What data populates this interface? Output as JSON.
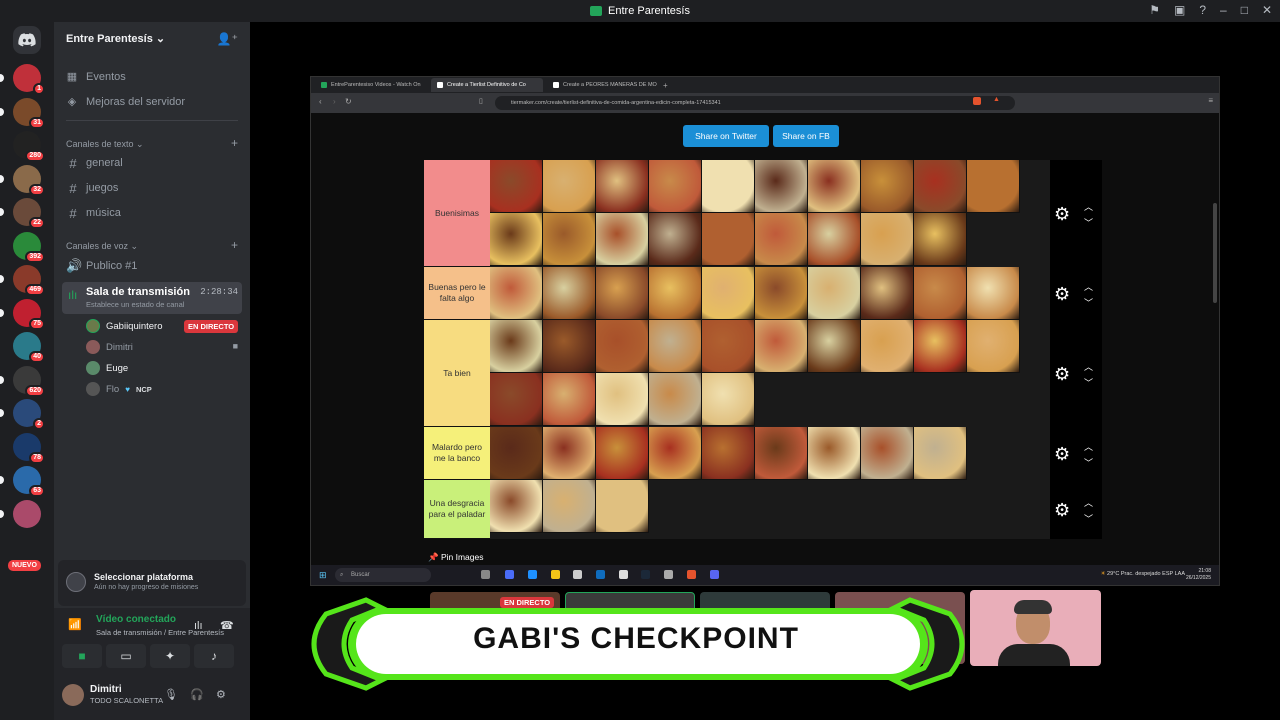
{
  "window": {
    "title": "Entre Parentesís"
  },
  "servers": {
    "badges": [
      "1",
      "31",
      "280",
      "32",
      "22",
      "392",
      "469",
      "75",
      "40",
      "620",
      "2",
      "78",
      "63"
    ],
    "nuevo": "NUEVO"
  },
  "channels": {
    "guild_name": "Entre Parentesís",
    "top_items": [
      "Eventos",
      "Mejoras del servidor"
    ],
    "text_category": "Canales de texto",
    "text_channels": [
      "general",
      "juegos",
      "música"
    ],
    "voice_category": "Canales de voz",
    "voice_channels": [
      "Publico #1"
    ],
    "stage": {
      "name": "Sala de transmisión",
      "status": "Establece un estado de canal",
      "timer": "2:28:34"
    },
    "members": [
      {
        "name": "Gabiiquintero",
        "color": "#f2f3f5",
        "badge": "EN DIRECTO"
      },
      {
        "name": "Dimitri",
        "color": "#949ba4"
      },
      {
        "name": "Euge",
        "color": "#f2f3f5"
      },
      {
        "name": "Flo",
        "color": "#949ba4",
        "tag": "NCP"
      }
    ]
  },
  "platform_panel": {
    "title": "Seleccionar plataforma",
    "subtitle": "Aún no hay progreso de misiones"
  },
  "voice_panel": {
    "title": "Vídeo conectado",
    "subtitle": "Sala de transmisión / Entre Parentesís"
  },
  "user_panel": {
    "name": "Dimitri",
    "status": "TODO SCALONETTA"
  },
  "browser": {
    "tabs": [
      "EntreParentesiso Videos - Watch On",
      "Create a Tierlist Definitivo de Co",
      "Create a PEORES MANERAS DE MO"
    ],
    "url": "tiermaker.com/create/tierlist-definitiva-de-comida-argentina-edicin-completa-17415341",
    "share_twitter": "Share on Twitter",
    "share_fb": "Share on FB",
    "pin_images": "Pin Images",
    "taskbar_search": "Buscar",
    "weather": "29°C  Prac. despejado",
    "time": "21:08",
    "date": "26/12/2025",
    "lang": "ESP LAA"
  },
  "tiers": [
    {
      "label": "Buenisimas",
      "color": "#f28c8c",
      "count": 19,
      "height": 107
    },
    {
      "label": "Buenas pero le falta algo",
      "color": "#f5c08a",
      "count": 10,
      "height": 53
    },
    {
      "label": "Ta bien",
      "color": "#f7dc80",
      "count": 15,
      "height": 107
    },
    {
      "label": "Malardo pero me la banco",
      "color": "#f5f07a",
      "count": 9,
      "height": 53
    },
    {
      "label": "Una desgracia para el paladar",
      "color": "#c9f07a",
      "count": 3,
      "height": 59
    }
  ],
  "stream": {
    "live_badge": "EN DIRECTO"
  },
  "banner": {
    "text": "GABI'S CHECKPOINT"
  }
}
